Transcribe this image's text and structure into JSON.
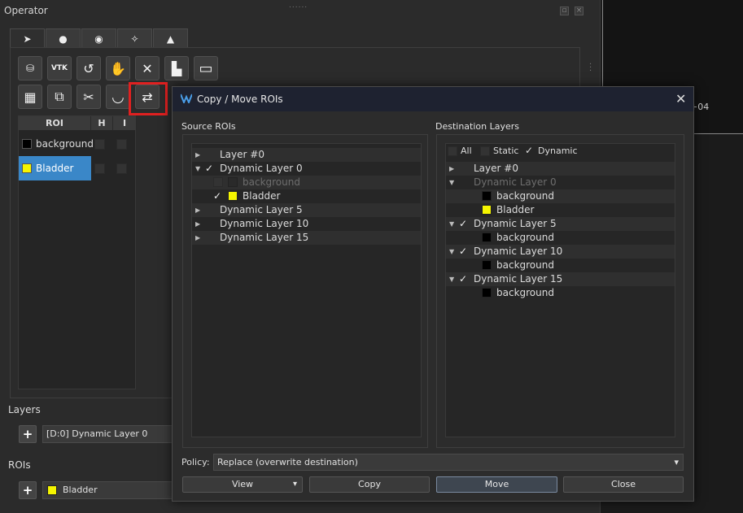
{
  "operator": {
    "title": "Operator",
    "grip": "......",
    "tabs": [
      {
        "icon": "pointer-icon",
        "glyph": "➤"
      },
      {
        "icon": "circle-icon",
        "glyph": "●"
      },
      {
        "icon": "eye-icon",
        "glyph": "◉"
      },
      {
        "icon": "wand-icon",
        "glyph": "✧"
      },
      {
        "icon": "graduation-cap-icon",
        "glyph": "▲"
      }
    ],
    "toolbar_row1": [
      {
        "icon": "load-icon",
        "glyph": "⛁"
      },
      {
        "icon": "vtk-icon",
        "glyph": "VTK"
      },
      {
        "icon": "reset-icon",
        "glyph": "↺"
      },
      {
        "icon": "hand-icon",
        "glyph": "✋"
      },
      {
        "icon": "close-icon",
        "glyph": "✕"
      },
      {
        "icon": "histogram-icon",
        "glyph": "▙"
      },
      {
        "icon": "rectangle-icon",
        "glyph": "▭"
      }
    ],
    "toolbar_row2": [
      {
        "icon": "table-icon",
        "glyph": "▦"
      },
      {
        "icon": "layers-icon",
        "glyph": "⧉"
      },
      {
        "icon": "scissors-icon",
        "glyph": "✂"
      },
      {
        "icon": "bowl-icon",
        "glyph": "◡"
      },
      {
        "icon": "swap-arrows-icon",
        "glyph": "⇄"
      }
    ],
    "roi_table": {
      "headers": [
        "ROI",
        "H",
        "I"
      ],
      "rows": [
        {
          "name": "background",
          "color": "#000000",
          "selected": false
        },
        {
          "name": "Bladder",
          "color": "#f5f500",
          "selected": true
        }
      ]
    },
    "layers_label": "Layers",
    "layers_combo": "[D:0] Dynamic Layer 0",
    "rois_label": "ROIs",
    "rois_combo": "Bladder",
    "add_glyph": "+"
  },
  "right_panel": {
    "text": "+04"
  },
  "dialog": {
    "title": "Copy / Move ROIs",
    "close_glyph": "✕",
    "source_label": "Source ROIs",
    "source_tree": [
      {
        "label": "Layer #0",
        "arrow": "▶",
        "check": "",
        "indent": 0,
        "dim": false
      },
      {
        "label": "Dynamic Layer 0",
        "arrow": "▼",
        "check": "✓",
        "indent": 0,
        "dim": false
      },
      {
        "label": "background",
        "arrow": "",
        "check": "",
        "indent": 1,
        "dim": true,
        "swatch": "#2a2a2a"
      },
      {
        "label": "Bladder",
        "arrow": "",
        "check": "✓",
        "indent": 1,
        "dim": false,
        "swatch": "#f5f500"
      },
      {
        "label": "Dynamic Layer 5",
        "arrow": "▶",
        "check": "",
        "indent": 0,
        "dim": false
      },
      {
        "label": "Dynamic Layer 10",
        "arrow": "▶",
        "check": "",
        "indent": 0,
        "dim": false
      },
      {
        "label": "Dynamic Layer 15",
        "arrow": "▶",
        "check": "",
        "indent": 0,
        "dim": false
      }
    ],
    "dest_label": "Destination Layers",
    "dest_filters": [
      {
        "label": "All",
        "checked": false
      },
      {
        "label": "Static",
        "checked": false
      },
      {
        "label": "Dynamic",
        "checked": true
      }
    ],
    "dest_tree": [
      {
        "label": "Layer #0",
        "arrow": "▶",
        "check": "",
        "indent": 0,
        "dim": false
      },
      {
        "label": "Dynamic Layer 0",
        "arrow": "▼",
        "check": "",
        "indent": 0,
        "dim": true
      },
      {
        "label": "background",
        "arrow": "",
        "check": "",
        "indent": 1,
        "dim": false,
        "swatch": "#000000"
      },
      {
        "label": "Bladder",
        "arrow": "",
        "check": "",
        "indent": 1,
        "dim": false,
        "swatch": "#f5f500"
      },
      {
        "label": "Dynamic Layer 5",
        "arrow": "▼",
        "check": "✓",
        "indent": 0,
        "dim": false
      },
      {
        "label": "background",
        "arrow": "",
        "check": "",
        "indent": 1,
        "dim": false,
        "swatch": "#000000"
      },
      {
        "label": "Dynamic Layer 10",
        "arrow": "▼",
        "check": "✓",
        "indent": 0,
        "dim": false
      },
      {
        "label": "background",
        "arrow": "",
        "check": "",
        "indent": 1,
        "dim": false,
        "swatch": "#000000"
      },
      {
        "label": "Dynamic Layer 15",
        "arrow": "▼",
        "check": "✓",
        "indent": 0,
        "dim": false
      },
      {
        "label": "background",
        "arrow": "",
        "check": "",
        "indent": 1,
        "dim": false,
        "swatch": "#000000"
      }
    ],
    "policy_label": "Policy:",
    "policy_value": "Replace (overwrite destination)",
    "dropdown_glyph": "▾",
    "buttons": {
      "view": "View",
      "copy": "Copy",
      "move": "Move",
      "close": "Close"
    }
  },
  "colors": {
    "selected_row": "#3a87c8",
    "highlight": "#e02020",
    "dialog_title_bg": "#1e2230"
  }
}
